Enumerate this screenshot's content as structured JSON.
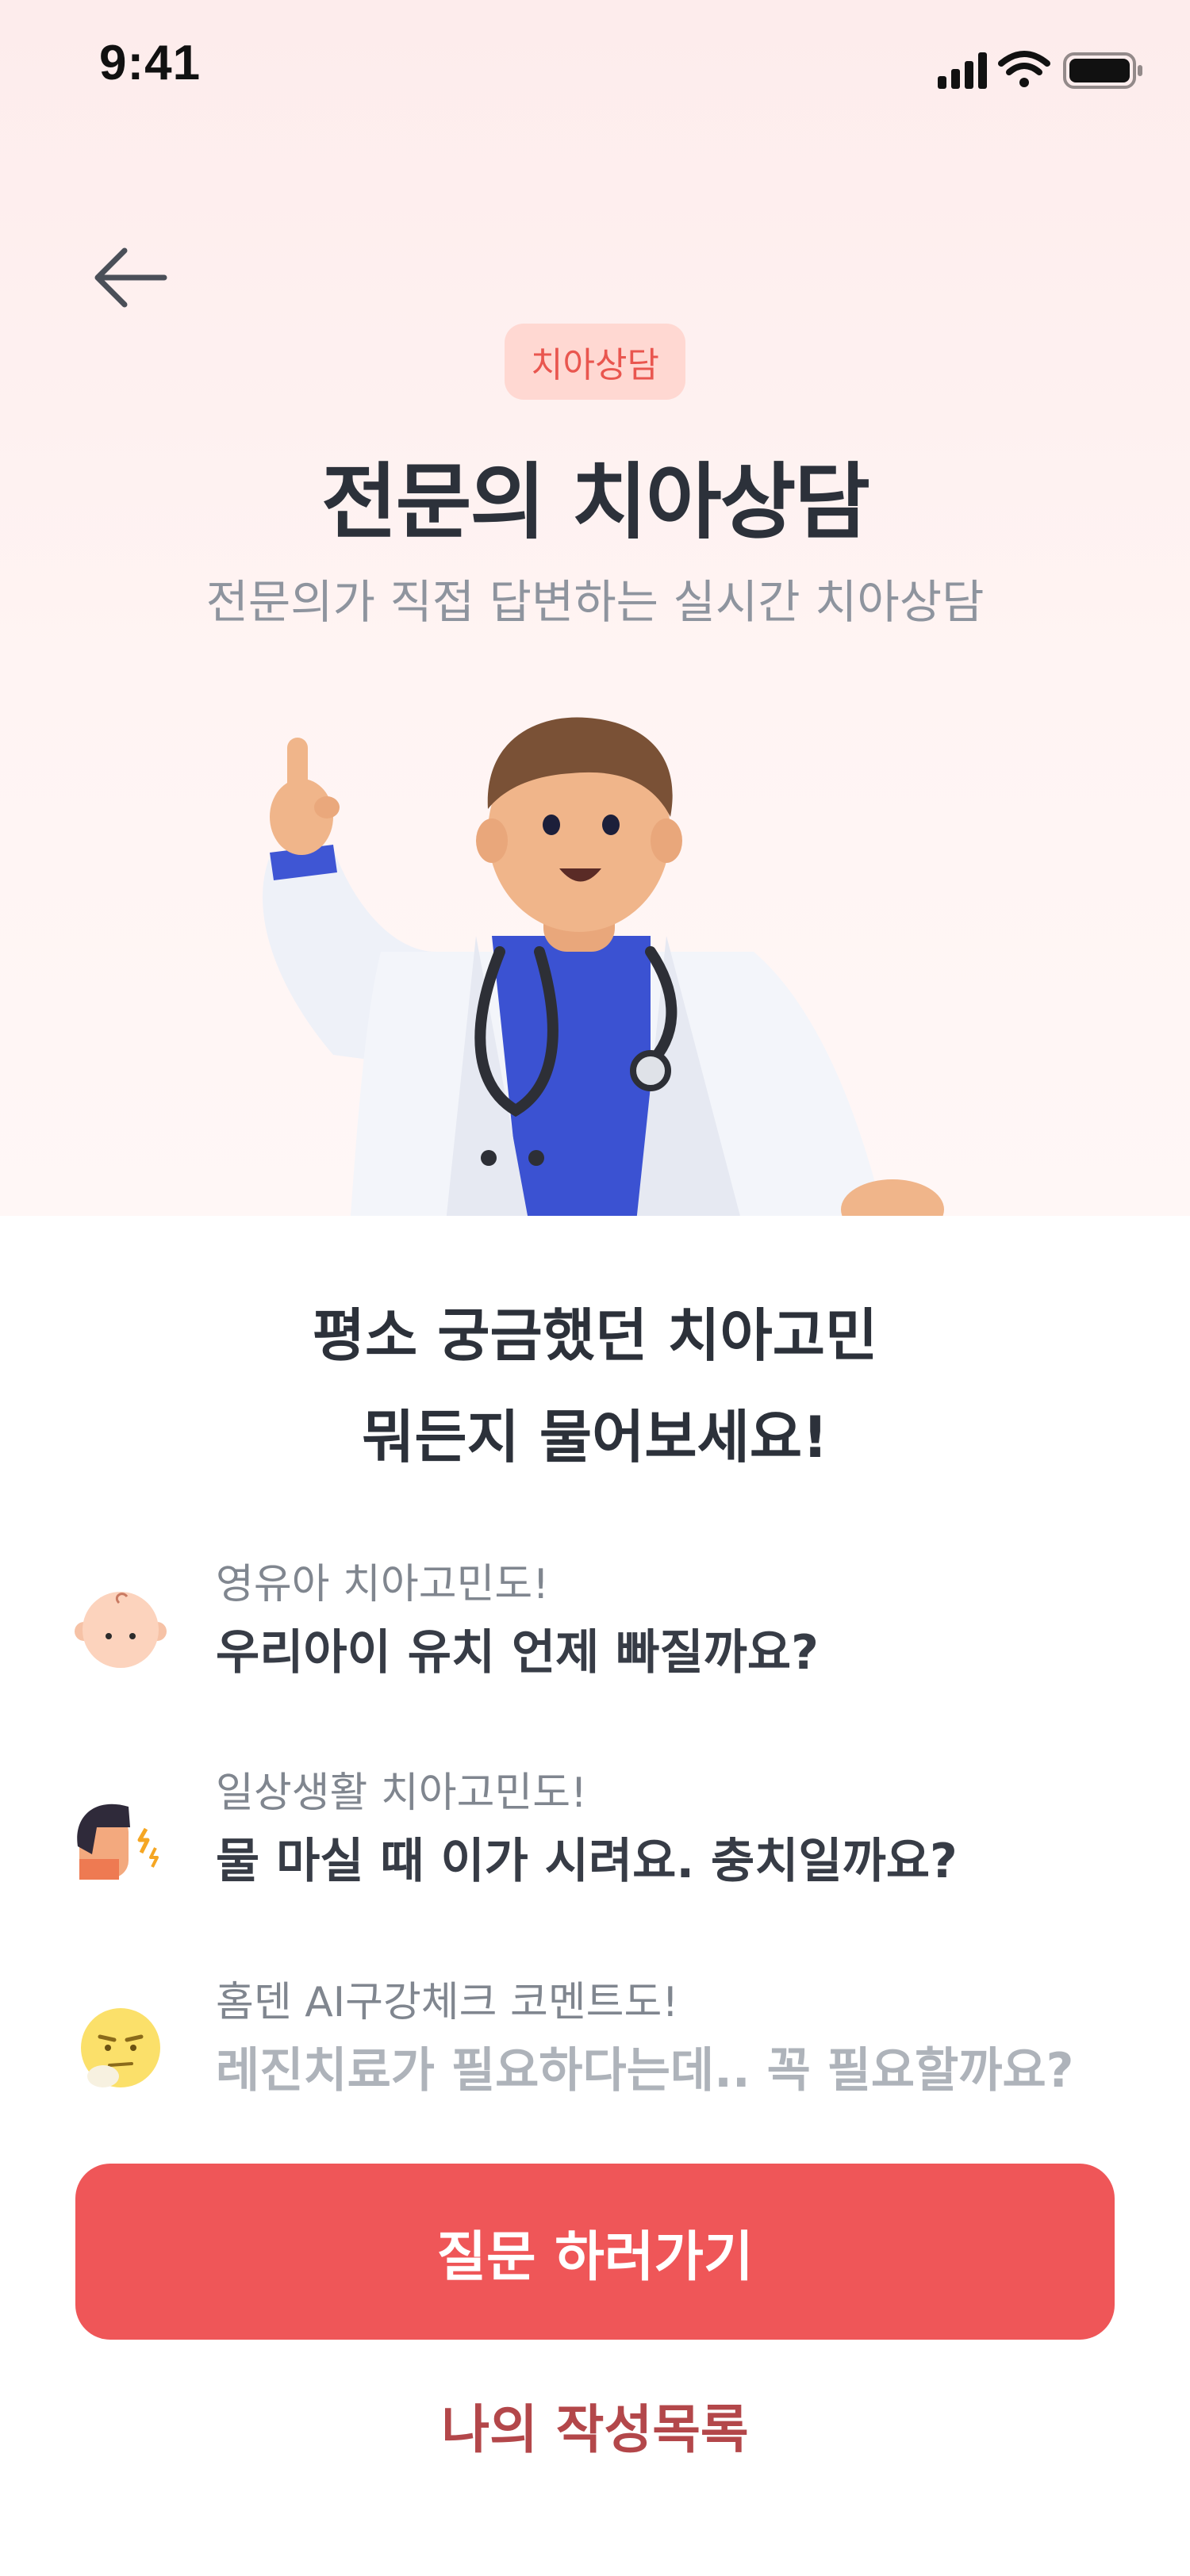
{
  "status_bar": {
    "time": "9:41",
    "icons": [
      "signal-icon",
      "wifi-icon",
      "battery-icon"
    ]
  },
  "header": {
    "badge": "치아상담",
    "title": "전문의 치아상담",
    "subtitle": "전문의가 직접 답변하는 실시간 치아상담"
  },
  "main": {
    "question_line1": "평소 궁금했던 치아고민",
    "question_line2": "뭐든지 물어보세요!",
    "features": [
      {
        "icon": "baby-face-icon",
        "caption": "영유아 치아고민도!",
        "text": "우리아이 유치 언제 빠질까요?"
      },
      {
        "icon": "man-toothache-icon",
        "caption": "일상생활 치아고민도!",
        "text": "물 마실 때 이가 시려요. 충치일까요?"
      },
      {
        "icon": "thinking-face-icon",
        "caption": "홈덴 AI구강체크 코멘트도!",
        "text": "레진치료가 필요하다는데.. 꼭 필요할까요?"
      }
    ]
  },
  "actions": {
    "primary": "질문 하러가기",
    "secondary": "나의 작성목록"
  },
  "colors": {
    "accent": "#ef5658",
    "badge_bg": "#ffd8d2",
    "badge_text": "#e9564f",
    "secondary_link": "#b3474a"
  }
}
